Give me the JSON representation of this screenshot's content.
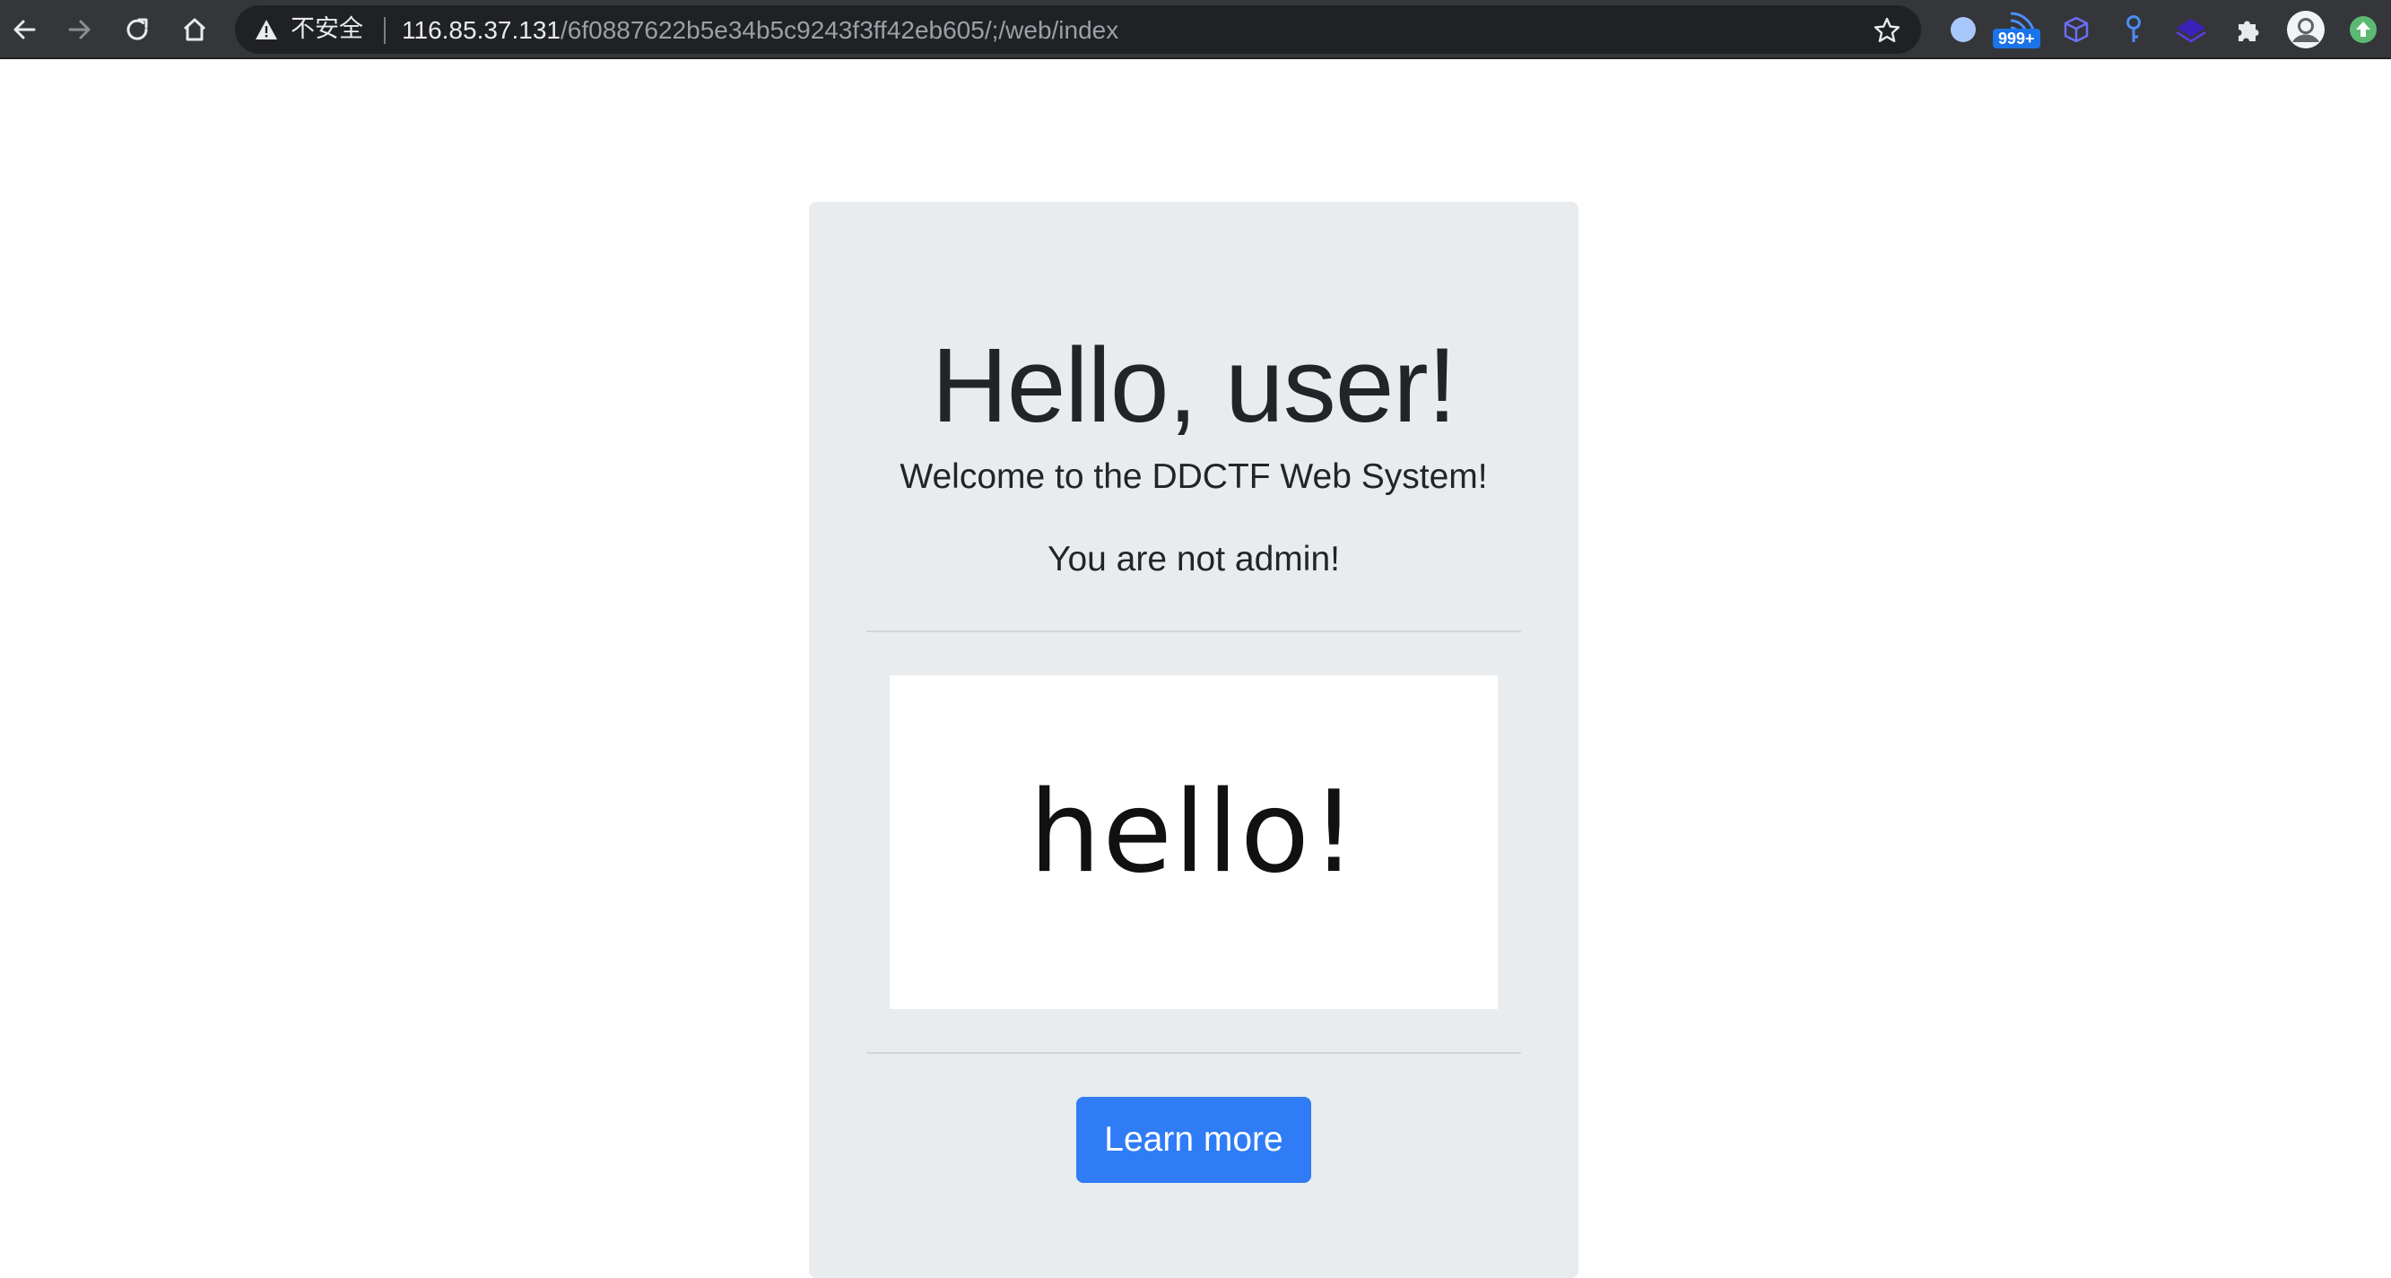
{
  "browser": {
    "nav": {
      "back_icon": "arrow-left-icon",
      "forward_icon": "arrow-right-icon",
      "reload_icon": "reload-icon",
      "home_icon": "home-icon"
    },
    "omnibox": {
      "security_icon": "warning-triangle-icon",
      "security_label": "不安全",
      "url_host": "116.85.37.131",
      "url_path": "/6f0887622b5e34b5c9243f3ff42eb605/;/web/index",
      "bookmark_icon": "star-icon"
    },
    "extensions": {
      "badge_text": "999+",
      "icons": [
        "circle-extension-icon",
        "rss-extension-icon",
        "cube-extension-icon",
        "key-extension-icon",
        "layers-extension-icon",
        "puzzle-icon",
        "avatar",
        "update-icon"
      ]
    },
    "colors": {
      "toolbar_bg": "#35363a",
      "omnibox_bg": "#202124",
      "badge_bg": "#1a73e8"
    }
  },
  "page": {
    "title": "Hello, user!",
    "welcome": "Welcome to the DDCTF Web System!",
    "status": "You are not admin!",
    "image_text": "hello!",
    "button_label": "Learn more",
    "colors": {
      "jumbotron_bg": "#e9ecef",
      "button_bg": "#2f7cf6",
      "text": "#212529"
    }
  }
}
